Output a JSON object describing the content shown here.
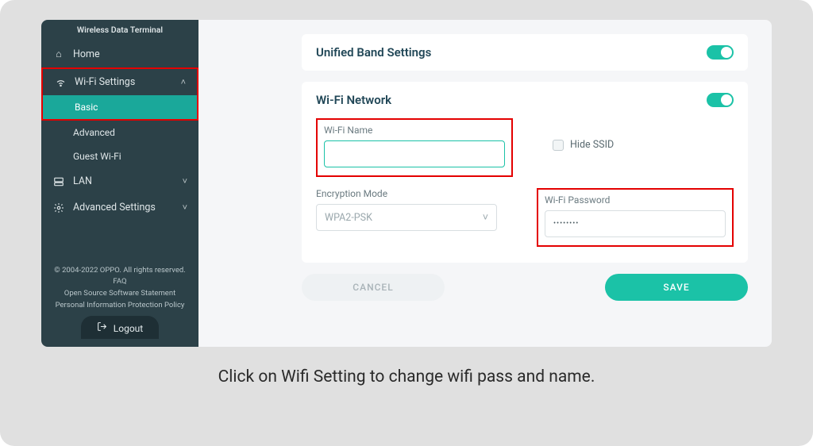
{
  "brand": "Wireless Data Terminal",
  "sidebar": {
    "home": "Home",
    "wifi": "Wi-Fi Settings",
    "wifi_sub": {
      "basic": "Basic",
      "advanced": "Advanced",
      "guest": "Guest Wi-Fi"
    },
    "lan": "LAN",
    "advanced": "Advanced Settings"
  },
  "footer": {
    "copyright": "© 2004-2022 OPPO. All rights reserved.",
    "faq": "FAQ",
    "oss": "Open Source Software Statement",
    "privacy": "Personal Information Protection Policy"
  },
  "logout": "Logout",
  "main": {
    "unified": "Unified Band Settings",
    "network": "Wi-Fi Network",
    "wifi_name_label": "Wi-Fi Name",
    "wifi_name_value": "",
    "hide_ssid": "Hide SSID",
    "enc_label": "Encryption Mode",
    "enc_value": "WPA2-PSK",
    "pw_label": "Wi-Fi Password",
    "pw_value": "••••••••",
    "cancel": "CANCEL",
    "save": "SAVE"
  },
  "caption": "Click on Wifi Setting to change wifi pass and name."
}
